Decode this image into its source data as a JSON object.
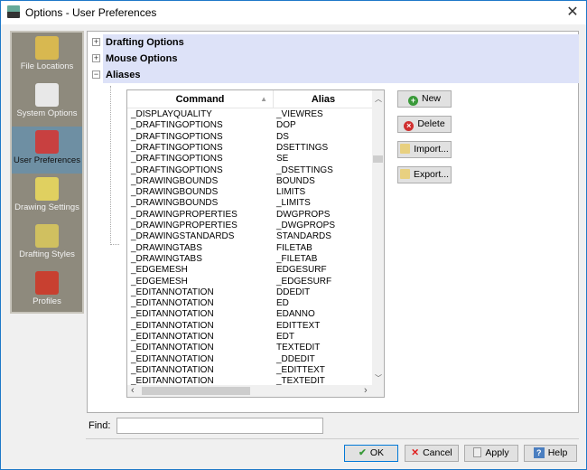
{
  "window": {
    "title": "Options - User Preferences",
    "close": "✕"
  },
  "sidebar": {
    "items": [
      {
        "label": "File Locations",
        "color": "#d8b850"
      },
      {
        "label": "System Options",
        "color": "#e8e8e8"
      },
      {
        "label": "User Preferences",
        "color": "#c84040",
        "selected": true
      },
      {
        "label": "Drawing Settings",
        "color": "#e0d060"
      },
      {
        "label": "Drafting Styles",
        "color": "#d0c060"
      },
      {
        "label": "Profiles",
        "color": "#c84030"
      }
    ]
  },
  "tree": {
    "items": [
      {
        "label": "Drafting Options",
        "expander": "+"
      },
      {
        "label": "Mouse Options",
        "expander": "+"
      },
      {
        "label": "Aliases",
        "expander": "−"
      }
    ]
  },
  "aliases": {
    "columns": [
      "Command",
      "Alias"
    ],
    "rows": [
      [
        "_DISPLAYQUALITY",
        "_VIEWRES"
      ],
      [
        "_DRAFTINGOPTIONS",
        "DOP"
      ],
      [
        "_DRAFTINGOPTIONS",
        "DS"
      ],
      [
        "_DRAFTINGOPTIONS",
        "DSETTINGS"
      ],
      [
        "_DRAFTINGOPTIONS",
        "SE"
      ],
      [
        "_DRAFTINGOPTIONS",
        "_DSETTINGS"
      ],
      [
        "_DRAWINGBOUNDS",
        "BOUNDS"
      ],
      [
        "_DRAWINGBOUNDS",
        "LIMITS"
      ],
      [
        "_DRAWINGBOUNDS",
        "_LIMITS"
      ],
      [
        "_DRAWINGPROPERTIES",
        "DWGPROPS"
      ],
      [
        "_DRAWINGPROPERTIES",
        "_DWGPROPS"
      ],
      [
        "_DRAWINGSTANDARDS",
        "STANDARDS"
      ],
      [
        "_DRAWINGTABS",
        "FILETAB"
      ],
      [
        "_DRAWINGTABS",
        "_FILETAB"
      ],
      [
        "_EDGEMESH",
        "EDGESURF"
      ],
      [
        "_EDGEMESH",
        "_EDGESURF"
      ],
      [
        "_EDITANNOTATION",
        "DDEDIT"
      ],
      [
        "_EDITANNOTATION",
        "ED"
      ],
      [
        "_EDITANNOTATION",
        "EDANNO"
      ],
      [
        "_EDITANNOTATION",
        "EDITTEXT"
      ],
      [
        "_EDITANNOTATION",
        "EDT"
      ],
      [
        "_EDITANNOTATION",
        "TEXTEDIT"
      ],
      [
        "_EDITANNOTATION",
        "_DDEDIT"
      ],
      [
        "_EDITANNOTATION",
        "_EDITTEXT"
      ],
      [
        "_EDITANNOTATION",
        "_TEXTEDIT"
      ]
    ]
  },
  "actions": {
    "new": "New",
    "delete": "Delete",
    "import": "Import...",
    "export": "Export..."
  },
  "find": {
    "label": "Find:",
    "value": ""
  },
  "footer": {
    "ok": "OK",
    "cancel": "Cancel",
    "apply": "Apply",
    "help": "Help"
  }
}
